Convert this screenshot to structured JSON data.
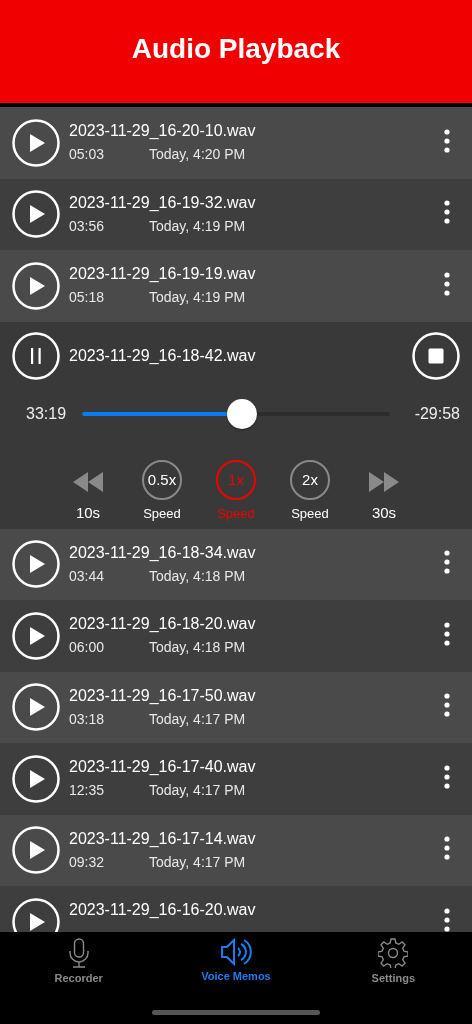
{
  "header": {
    "title": "Audio Playback"
  },
  "recordings": [
    {
      "kind": "row",
      "name": "2023-11-29_16-20-10.wav",
      "duration": "05:03",
      "date": "Today, 4:20 PM"
    },
    {
      "kind": "row",
      "name": "2023-11-29_16-19-32.wav",
      "duration": "03:56",
      "date": "Today, 4:19 PM"
    },
    {
      "kind": "row",
      "name": "2023-11-29_16-19-19.wav",
      "duration": "05:18",
      "date": "Today, 4:19 PM"
    },
    {
      "kind": "player",
      "name": "2023-11-29_16-18-42.wav",
      "elapsed": "33:19",
      "remaining": "-29:58",
      "level": 0.52,
      "rewind": "10s",
      "forward": "30s",
      "speeds": [
        {
          "value": "0.5x",
          "label": "Speed",
          "selected": false
        },
        {
          "value": "1x",
          "label": "Speed",
          "selected": true
        },
        {
          "value": "2x",
          "label": "Speed",
          "selected": false
        }
      ]
    },
    {
      "kind": "row",
      "name": "2023-11-29_16-18-34.wav",
      "duration": "03:44",
      "date": "Today, 4:18 PM"
    },
    {
      "kind": "row",
      "name": "2023-11-29_16-18-20.wav",
      "duration": "06:00",
      "date": "Today, 4:18 PM"
    },
    {
      "kind": "row",
      "name": "2023-11-29_16-17-50.wav",
      "duration": "03:18",
      "date": "Today, 4:17 PM"
    },
    {
      "kind": "row",
      "name": "2023-11-29_16-17-40.wav",
      "duration": "12:35",
      "date": "Today, 4:17 PM"
    },
    {
      "kind": "row",
      "name": "2023-11-29_16-17-14.wav",
      "duration": "09:32",
      "date": "Today, 4:17 PM"
    },
    {
      "kind": "row",
      "name": "2023-11-29_16-16-20.wav"
    }
  ],
  "tabs": [
    {
      "kind": "mic",
      "label": "Recorder",
      "selected": false
    },
    {
      "kind": "speaker",
      "label": "Voice Memos",
      "selected": true
    },
    {
      "kind": "gear",
      "label": "Settings",
      "selected": false
    }
  ]
}
